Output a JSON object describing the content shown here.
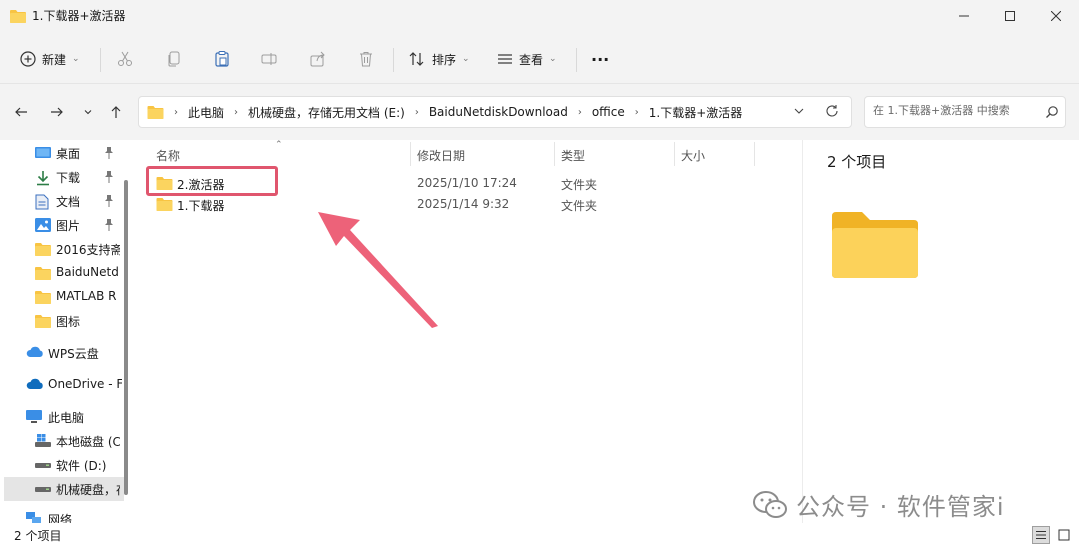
{
  "window": {
    "title": "1.下载器+激活器"
  },
  "toolbar": {
    "new_label": "新建",
    "sort_label": "排序",
    "view_label": "查看",
    "more_label": "···"
  },
  "address": {
    "crumbs": [
      "此电脑",
      "机械硬盘，存储无用文档 (E:)",
      "BaiduNetdiskDownload",
      "office",
      "1.下载器+激活器"
    ]
  },
  "search": {
    "placeholder": "在 1.下载器+激活器 中搜索"
  },
  "sidebar": {
    "items": [
      {
        "label": "桌面",
        "icon": "desktop-icon",
        "pinned": true
      },
      {
        "label": "下载",
        "icon": "download-icon",
        "pinned": true
      },
      {
        "label": "文档",
        "icon": "document-icon",
        "pinned": true
      },
      {
        "label": "图片",
        "icon": "picture-icon",
        "pinned": true
      },
      {
        "label": "2016支持斋",
        "icon": "folder-icon",
        "pinned": false
      },
      {
        "label": "BaiduNetd",
        "icon": "folder-icon",
        "pinned": false
      },
      {
        "label": "MATLAB R",
        "icon": "folder-icon",
        "pinned": false
      },
      {
        "label": "图标",
        "icon": "folder-icon",
        "pinned": false
      }
    ],
    "cloud": [
      {
        "label": "WPS云盘",
        "icon": "wps-cloud-icon"
      },
      {
        "label": "OneDrive - F",
        "icon": "onedrive-icon"
      }
    ],
    "pc_label": "此电脑",
    "drives": [
      {
        "label": "本地磁盘 (C",
        "icon": "windows-drive-icon"
      },
      {
        "label": "软件 (D:)",
        "icon": "drive-icon"
      },
      {
        "label": "机械硬盘，存",
        "icon": "drive-icon",
        "selected": true
      }
    ],
    "network_label": "网络"
  },
  "columns": {
    "name": "名称",
    "date": "修改日期",
    "type": "类型",
    "size": "大小"
  },
  "files": [
    {
      "name": "2.激活器",
      "date": "2025/1/10 17:24",
      "type": "文件夹"
    },
    {
      "name": "1.下载器",
      "date": "2025/1/14 9:32",
      "type": "文件夹"
    }
  ],
  "preview": {
    "count": "2 个项目"
  },
  "status": {
    "text": "2 个项目"
  },
  "watermark": {
    "text": "公众号 · 软件管家i"
  },
  "colors": {
    "folder": "#f8c443",
    "highlight": "#e0566e",
    "arrow": "#ec5a72"
  }
}
